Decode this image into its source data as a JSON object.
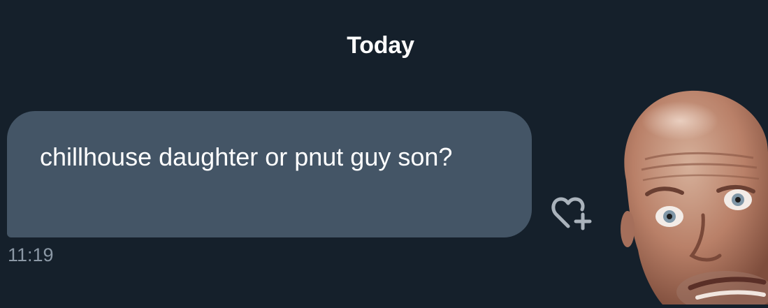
{
  "conversation": {
    "date_divider": "Today",
    "messages": [
      {
        "text": "chillhouse daughter or pnut guy son?",
        "time": "11:19",
        "direction": "received"
      }
    ]
  },
  "icons": {
    "reaction": "heart-plus-icon"
  },
  "colors": {
    "background": "#15202b",
    "bubble": "#445566",
    "timestamp": "#8b98a5",
    "text": "#ffffff"
  }
}
